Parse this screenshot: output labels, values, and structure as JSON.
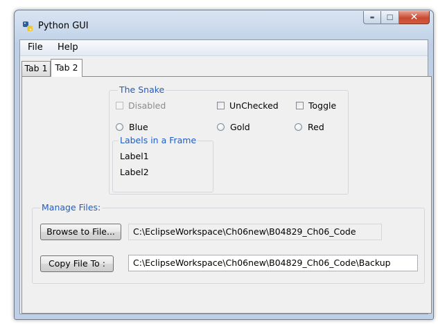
{
  "window": {
    "title": "Python GUI",
    "caption": {
      "minimize": "▬",
      "maximize": "☐",
      "close": "✕"
    }
  },
  "menubar": [
    "File",
    "Help"
  ],
  "tabs": [
    {
      "label": "Tab 1",
      "active": false
    },
    {
      "label": "Tab 2",
      "active": true
    }
  ],
  "snake_frame": {
    "title": "The Snake",
    "checkboxes": [
      {
        "label": "Disabled",
        "checked": false,
        "disabled": true
      },
      {
        "label": "UnChecked",
        "checked": false,
        "disabled": false
      },
      {
        "label": "Toggle",
        "checked": false,
        "disabled": false
      }
    ],
    "radios": [
      {
        "label": "Blue",
        "selected": false
      },
      {
        "label": "Gold",
        "selected": false
      },
      {
        "label": "Red",
        "selected": false
      }
    ],
    "labels_frame": {
      "title": "Labels in a Frame",
      "labels": [
        "Label1",
        "Label2"
      ]
    }
  },
  "manage_files": {
    "title": "Manage Files:",
    "browse_button": "Browse to File...",
    "browse_path": "C:\\EclipseWorkspace\\Ch06new\\B04829_Ch06_Code",
    "copy_button": "Copy File To :",
    "copy_path": "C:\\EclipseWorkspace\\Ch06new\\B04829_Ch06_Code\\Backup"
  },
  "colors": {
    "group_title": "#1f5cc4",
    "frame_bg": "#bfd0e6",
    "client_bg": "#f0f0f0"
  }
}
